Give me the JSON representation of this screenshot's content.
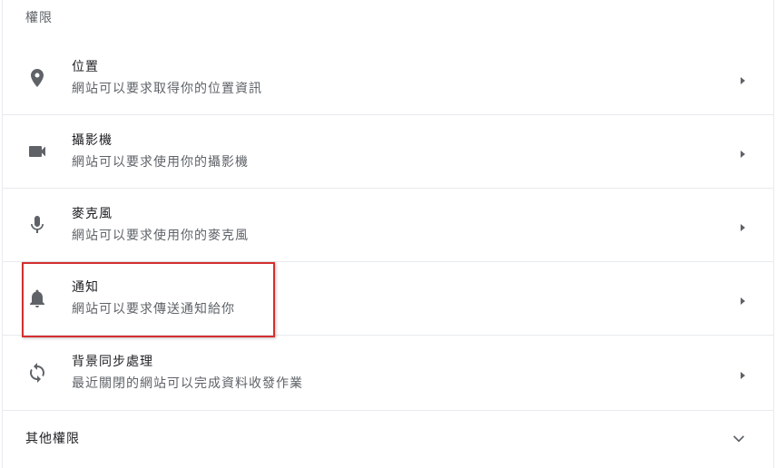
{
  "section": {
    "title": "權限"
  },
  "permissions": [
    {
      "icon": "location-pin-icon",
      "label": "位置",
      "description": "網站可以要求取得你的位置資訊"
    },
    {
      "icon": "video-camera-icon",
      "label": "攝影機",
      "description": "網站可以要求使用你的攝影機"
    },
    {
      "icon": "microphone-icon",
      "label": "麥克風",
      "description": "網站可以要求使用你的麥克風"
    },
    {
      "icon": "bell-icon",
      "label": "通知",
      "description": "網站可以要求傳送通知給你"
    },
    {
      "icon": "sync-icon",
      "label": "背景同步處理",
      "description": "最近關閉的網站可以完成資料收發作業"
    }
  ],
  "more": {
    "label": "其他權限",
    "icon": "chevron-down-icon"
  },
  "colors": {
    "highlight": "#d32f2f",
    "icon": "#5f6368",
    "divider": "#e8eaed"
  }
}
